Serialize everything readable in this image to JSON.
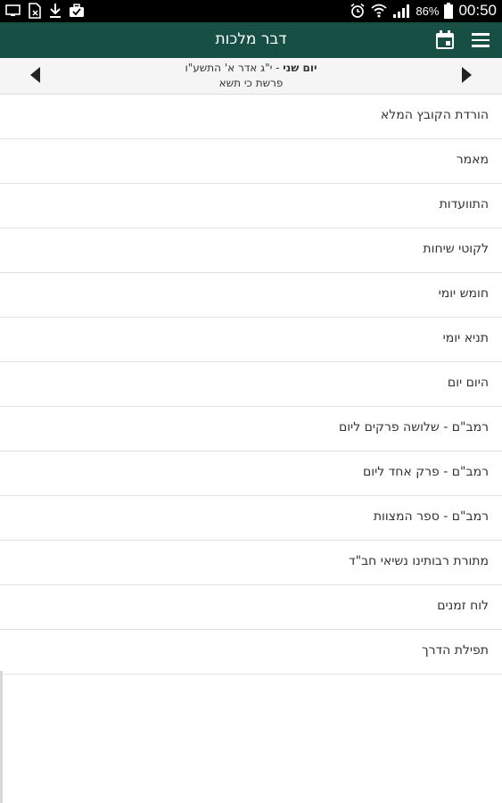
{
  "status_bar": {
    "battery": "86%",
    "time": "00:50"
  },
  "app_bar": {
    "title": "דבר מלכות"
  },
  "date_nav": {
    "day_label": "יום שני",
    "date": " - י\"ג אדר א' התשע\"ו",
    "parsha": "פרשת כי תשא"
  },
  "menu": {
    "items": [
      "הורדת הקובץ המלא",
      "מאמר",
      "התוועדות",
      "לקוטי שיחות",
      "חומש יומי",
      "תניא יומי",
      "היום יום",
      "רמב\"ם - שלושה פרקים ליום",
      "רמב\"ם - פרק אחד ליום",
      "רמב\"ם - ספר המצוות",
      "מתורת רבותינו נשיאי חב\"ד",
      "לוח זמנים",
      "תפילת הדרך"
    ]
  },
  "colors": {
    "app_bar": "#174f45",
    "status_bar": "#000000",
    "date_bar": "#f5f5f5"
  }
}
